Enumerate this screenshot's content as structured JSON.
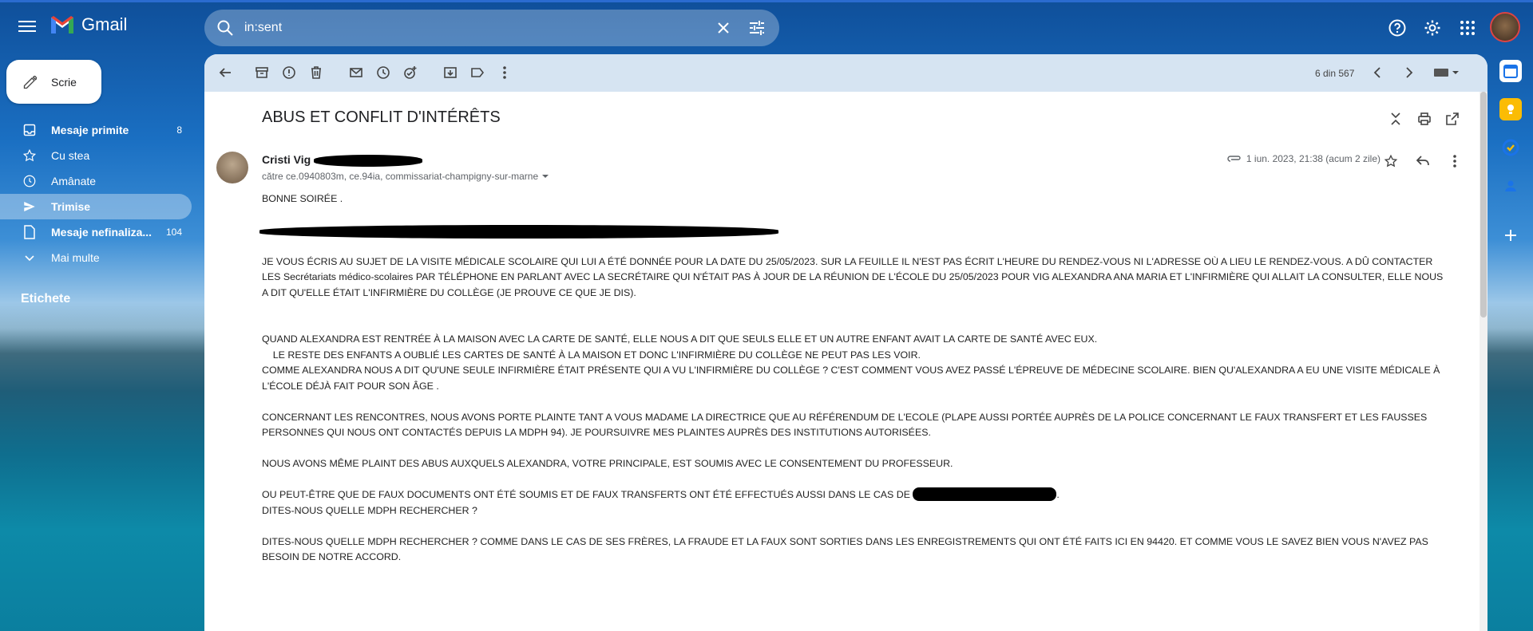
{
  "app": {
    "name": "Gmail"
  },
  "compose": {
    "label": "Scrie"
  },
  "nav": [
    {
      "label": "Mesaje primite",
      "count": "8",
      "icon": "inbox-icon",
      "bold": true
    },
    {
      "label": "Cu stea",
      "count": "",
      "icon": "star-icon"
    },
    {
      "label": "Amânate",
      "count": "",
      "icon": "clock-icon"
    },
    {
      "label": "Trimise",
      "count": "",
      "icon": "send-icon",
      "active": true,
      "bold": true
    },
    {
      "label": "Mesaje nefinaliza...",
      "count": "104",
      "icon": "draft-icon",
      "bold": true
    },
    {
      "label": "Mai multe",
      "count": "",
      "icon": "chevron-down-icon"
    }
  ],
  "labels_title": "Etichete",
  "search": {
    "value": "in:sent"
  },
  "pager": {
    "text": "6 din 567"
  },
  "email": {
    "subject": "ABUS ET CONFLIT D'INTÉRÊTS",
    "sender": "Cristi Vig",
    "recipients": "către ce.0940803m, ce.94ia, commissariat-champigny-sur-marne",
    "date": "1 iun. 2023, 21:38 (acum 2 zile)",
    "body": {
      "p1": "BONNE SOIRÉE .",
      "p2": "JE VOUS ÉCRIS AU SUJET DE LA VISITE MÉDICALE SCOLAIRE QUI LUI A ÉTÉ DONNÉE POUR LA DATE DU 25/05/2023. SUR LA FEUILLE IL N'EST PAS ÉCRIT L'HEURE DU RENDEZ-VOUS NI L'ADRESSE OÙ A LIEU LE RENDEZ-VOUS. A DÛ CONTACTER LES Secrétariats médico-scolaires PAR TÉLÉPHONE EN PARLANT AVEC LA SECRÉTAIRE QUI N'ÉTAIT PAS À JOUR DE LA RÉUNION DE L'ÉCOLE DU 25/05/2023 POUR VIG ALEXANDRA ANA MARIA ET L'INFIRMIÈRE QUI ALLAIT LA CONSULTER, ELLE NOUS A DIT QU'ELLE ÉTAIT L'INFIRMIÈRE DU COLLÈGE (JE PROUVE CE QUE JE DIS).",
      "p3": "QUAND ALEXANDRA EST RENTRÉE À LA MAISON AVEC LA CARTE DE SANTÉ, ELLE NOUS A DIT QUE SEULS ELLE ET UN AUTRE ENFANT AVAIT LA CARTE DE SANTÉ AVEC EUX.",
      "p4": "    LE RESTE DES ENFANTS A OUBLIÉ LES CARTES DE SANTÉ À LA MAISON ET DONC L'INFIRMIÈRE DU COLLÈGE NE PEUT PAS LES VOIR.",
      "p5": "COMME ALEXANDRA NOUS A DIT QU'UNE SEULE INFIRMIÈRE ÉTAIT PRÉSENTE QUI A VU L'INFIRMIÈRE DU COLLÈGE ? C'EST COMMENT VOUS AVEZ PASSÉ L'ÉPREUVE DE MÉDECINE SCOLAIRE. BIEN QU'ALEXANDRA A EU UNE VISITE MÉDICALE À L'ÉCOLE DÉJÀ FAIT POUR SON ÂGE .",
      "p6": "CONCERNANT LES RENCONTRES, NOUS AVONS PORTE PLAINTE TANT A VOUS MADAME LA DIRECTRICE QUE AU RÉFÉRENDUM DE L'ECOLE (PLAPE AUSSI PORTÉE AUPRÈS DE LA POLICE CONCERNANT LE FAUX TRANSFERT ET LES FAUSSES PERSONNES QUI NOUS ONT CONTACTÉS DEPUIS LA MDPH 94). JE POURSUIVRE MES PLAINTES AUPRÈS DES INSTITUTIONS AUTORISÉES.",
      "p7": "NOUS AVONS MÊME PLAINT DES ABUS AUXQUELS ALEXANDRA, VOTRE PRINCIPALE, EST SOUMIS AVEC LE CONSENTEMENT DU PROFESSEUR.",
      "p8": "OU PEUT-ÊTRE QUE DE FAUX DOCUMENTS ONT ÉTÉ SOUMIS ET DE FAUX TRANSFERTS ONT ÉTÉ EFFECTUÉS AUSSI DANS LE CAS DE",
      "p8_end": ".",
      "p9": "DITES-NOUS QUELLE MDPH RECHERCHER ?",
      "p10": "DITES-NOUS QUELLE MDPH RECHERCHER ? COMME DANS LE CAS DE SES FRÈRES, LA FRAUDE ET LA FAUX SONT SORTIES DANS LES ENREGISTREMENTS QUI ONT ÉTÉ FAITS ICI EN 94420. ET COMME VOUS LE SAVEZ BIEN VOUS N'AVEZ PAS BESOIN DE NOTRE ACCORD."
    }
  },
  "colors": {
    "accent": "#0b57d0",
    "toolbar": "#d6e4f2",
    "nav_active": "rgba(255,255,255,0.35)"
  }
}
